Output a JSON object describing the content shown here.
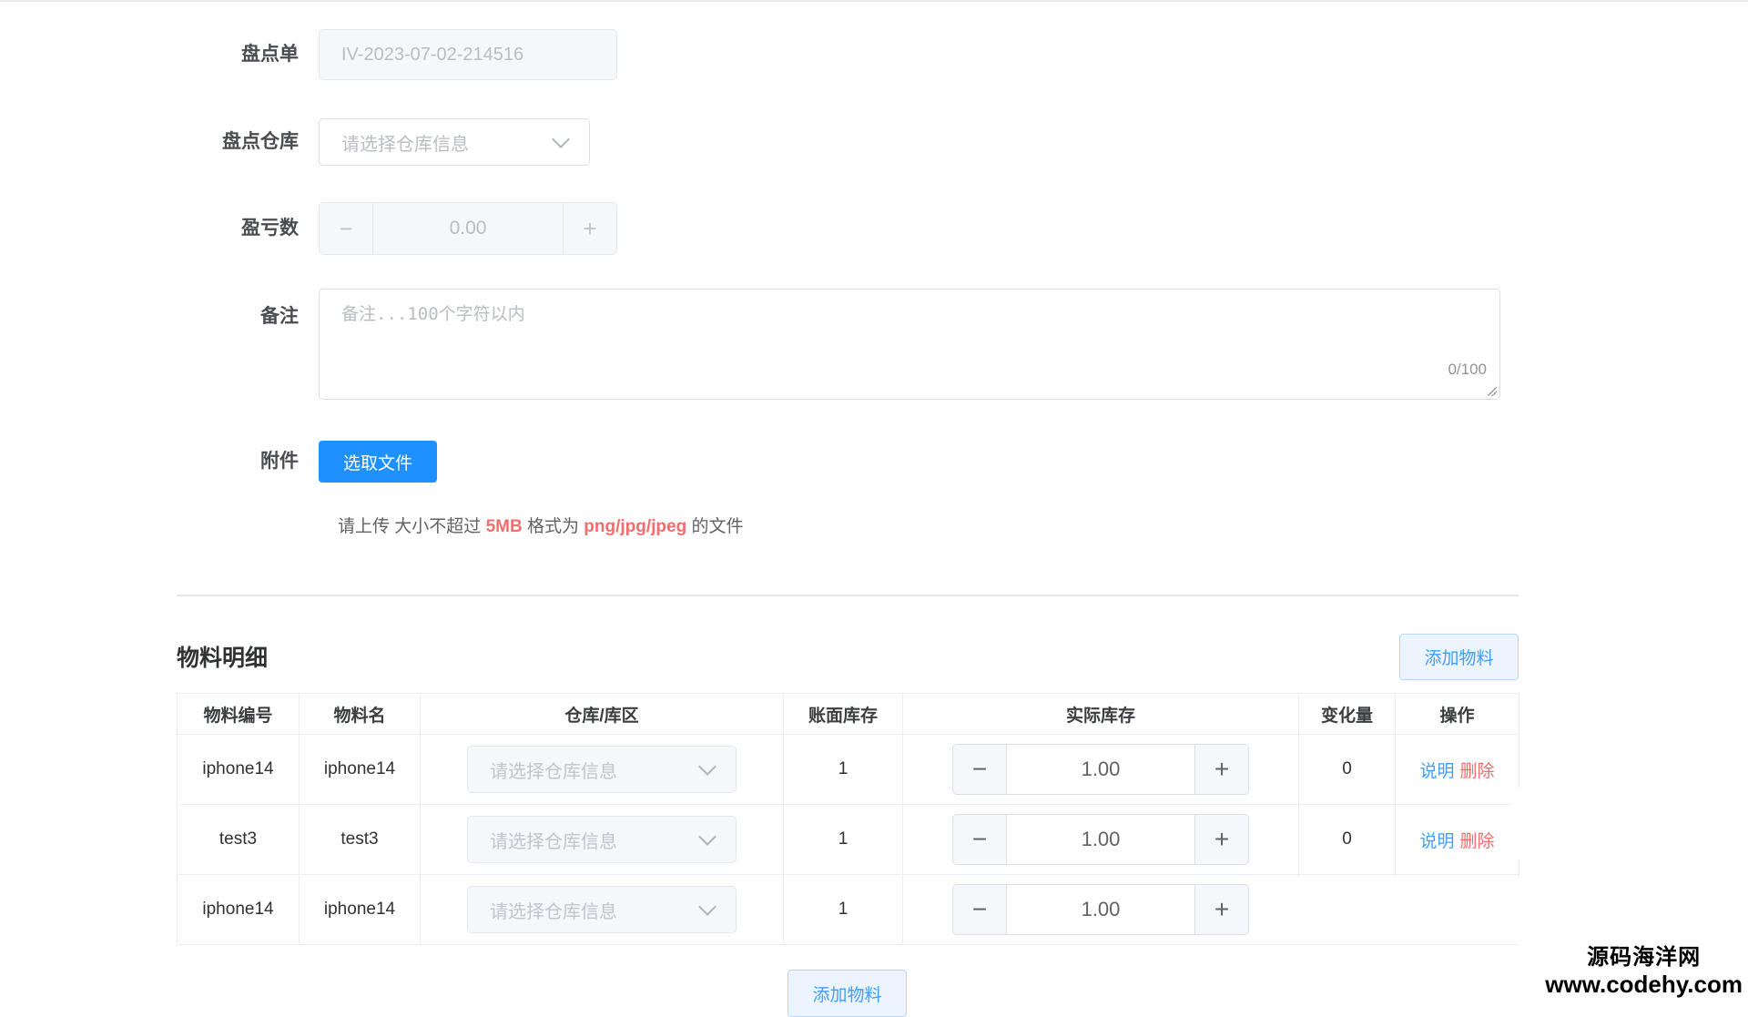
{
  "form": {
    "order": {
      "label": "盘点单",
      "value": "IV-2023-07-02-214516"
    },
    "warehouse": {
      "label": "盘点仓库",
      "placeholder": "请选择仓库信息"
    },
    "profit_loss": {
      "label": "盈亏数",
      "value": "0.00",
      "minus": "−",
      "plus": "+"
    },
    "remark": {
      "label": "备注",
      "placeholder": "备注...100个字符以内",
      "counter": "0/100"
    },
    "attachment": {
      "label": "附件",
      "button": "选取文件"
    },
    "tip": {
      "prefix": "请上传 大小不超过 ",
      "size": "5MB",
      "middle": " 格式为 ",
      "formats": "png/jpg/jpeg",
      "suffix": " 的文件"
    }
  },
  "materials": {
    "title": "物料明细",
    "add_button": "添加物料",
    "columns": [
      "物料编号",
      "物料名",
      "仓库/库区",
      "账面库存",
      "实际库存",
      "变化量",
      "操作"
    ],
    "rows": [
      {
        "code": "iphone14",
        "name": "iphone14",
        "warehouse_placeholder": "请选择仓库信息",
        "book_stock": "1",
        "actual_stock": "1.00",
        "change": "0",
        "action_explain": "说明",
        "action_delete": "删除"
      },
      {
        "code": "test3",
        "name": "test3",
        "warehouse_placeholder": "请选择仓库信息",
        "book_stock": "1",
        "actual_stock": "1.00",
        "change": "0",
        "action_explain": "说明",
        "action_delete": "删除"
      },
      {
        "code": "iphone14",
        "name": "iphone14",
        "warehouse_placeholder": "请选择仓库信息",
        "book_stock": "1",
        "actual_stock": "1.00",
        "change": "",
        "action_explain": "",
        "action_delete": ""
      }
    ],
    "stepper_minus": "−",
    "stepper_plus": "+",
    "bottom_add_button": "添加物料"
  },
  "watermark": {
    "line1": "源码海洋网",
    "line2": "www.codehy.com"
  },
  "colors": {
    "primary": "#1e90ff",
    "link": "#409eff",
    "danger": "#f56c6c",
    "border": "#dcdfe6"
  }
}
